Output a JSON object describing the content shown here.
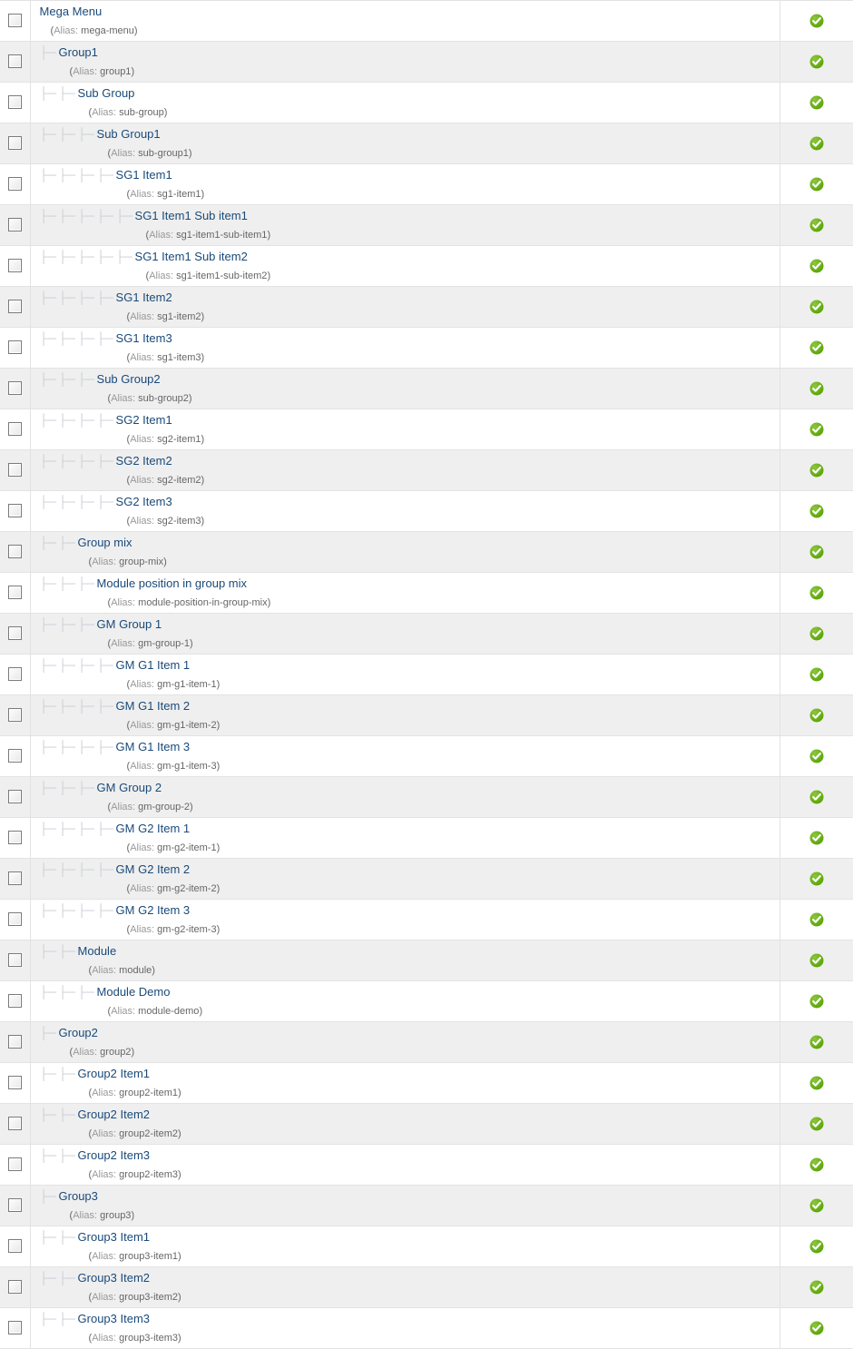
{
  "table": {
    "alias_prefix": "Alias:",
    "status_icon": "published-check-icon",
    "accent_link_color": "#1a4a7a",
    "status_color": "#5aa304",
    "row_alt_color": "#efefef",
    "tree_mark": "├─",
    "rows": [
      {
        "title": "Mega Menu",
        "alias": "mega-menu",
        "depth": 0,
        "status": "Published"
      },
      {
        "title": "Group1",
        "alias": "group1",
        "depth": 1,
        "status": "Published"
      },
      {
        "title": "Sub Group",
        "alias": "sub-group",
        "depth": 2,
        "status": "Published"
      },
      {
        "title": "Sub Group1",
        "alias": "sub-group1",
        "depth": 3,
        "status": "Published"
      },
      {
        "title": "SG1 Item1",
        "alias": "sg1-item1",
        "depth": 4,
        "status": "Published"
      },
      {
        "title": "SG1 Item1 Sub item1",
        "alias": "sg1-item1-sub-item1",
        "depth": 5,
        "status": "Published"
      },
      {
        "title": "SG1 Item1 Sub item2",
        "alias": "sg1-item1-sub-item2",
        "depth": 5,
        "status": "Published"
      },
      {
        "title": "SG1 Item2",
        "alias": "sg1-item2",
        "depth": 4,
        "status": "Published"
      },
      {
        "title": "SG1 Item3",
        "alias": "sg1-item3",
        "depth": 4,
        "status": "Published"
      },
      {
        "title": "Sub Group2",
        "alias": "sub-group2",
        "depth": 3,
        "status": "Published"
      },
      {
        "title": "SG2 Item1",
        "alias": "sg2-item1",
        "depth": 4,
        "status": "Published"
      },
      {
        "title": "SG2 Item2",
        "alias": "sg2-item2",
        "depth": 4,
        "status": "Published"
      },
      {
        "title": "SG2 Item3",
        "alias": "sg2-item3",
        "depth": 4,
        "status": "Published"
      },
      {
        "title": "Group mix",
        "alias": "group-mix",
        "depth": 2,
        "status": "Published"
      },
      {
        "title": "Module position in group mix",
        "alias": "module-position-in-group-mix",
        "depth": 3,
        "status": "Published"
      },
      {
        "title": "GM Group 1",
        "alias": "gm-group-1",
        "depth": 3,
        "status": "Published"
      },
      {
        "title": "GM G1 Item 1",
        "alias": "gm-g1-item-1",
        "depth": 4,
        "status": "Published"
      },
      {
        "title": "GM G1 Item 2",
        "alias": "gm-g1-item-2",
        "depth": 4,
        "status": "Published"
      },
      {
        "title": "GM G1 Item 3",
        "alias": "gm-g1-item-3",
        "depth": 4,
        "status": "Published"
      },
      {
        "title": "GM Group 2",
        "alias": "gm-group-2",
        "depth": 3,
        "status": "Published"
      },
      {
        "title": "GM G2 Item 1",
        "alias": "gm-g2-item-1",
        "depth": 4,
        "status": "Published"
      },
      {
        "title": "GM G2 Item 2",
        "alias": "gm-g2-item-2",
        "depth": 4,
        "status": "Published"
      },
      {
        "title": "GM G2 Item 3",
        "alias": "gm-g2-item-3",
        "depth": 4,
        "status": "Published"
      },
      {
        "title": "Module",
        "alias": "module",
        "depth": 2,
        "status": "Published"
      },
      {
        "title": "Module Demo",
        "alias": "module-demo",
        "depth": 3,
        "status": "Published"
      },
      {
        "title": "Group2",
        "alias": "group2",
        "depth": 1,
        "status": "Published"
      },
      {
        "title": "Group2 Item1",
        "alias": "group2-item1",
        "depth": 2,
        "status": "Published"
      },
      {
        "title": "Group2 Item2",
        "alias": "group2-item2",
        "depth": 2,
        "status": "Published"
      },
      {
        "title": "Group2 Item3",
        "alias": "group2-item3",
        "depth": 2,
        "status": "Published"
      },
      {
        "title": "Group3",
        "alias": "group3",
        "depth": 1,
        "status": "Published"
      },
      {
        "title": "Group3 Item1",
        "alias": "group3-item1",
        "depth": 2,
        "status": "Published"
      },
      {
        "title": "Group3 Item2",
        "alias": "group3-item2",
        "depth": 2,
        "status": "Published"
      },
      {
        "title": "Group3 Item3",
        "alias": "group3-item3",
        "depth": 2,
        "status": "Published"
      }
    ]
  }
}
